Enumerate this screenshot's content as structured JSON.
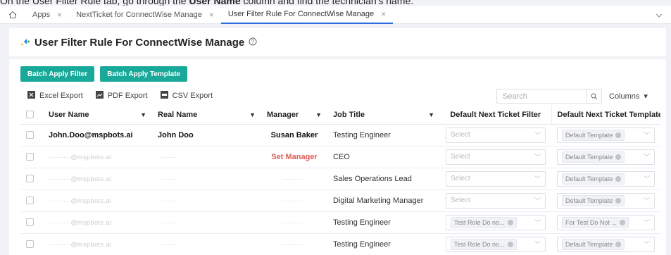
{
  "instruction": {
    "prefix": "On the User Filter Rule tab, go through the ",
    "bold": "User Name",
    "suffix": " column and find the technician's name."
  },
  "tabs": [
    {
      "label": "Apps"
    },
    {
      "label": "NextTicket for ConnectWise Manage"
    },
    {
      "label": "User Filter Rule For ConnectWise Manage"
    }
  ],
  "page": {
    "title": "User Filter Rule For ConnectWise Manage"
  },
  "actions": {
    "batch_filter": "Batch Apply Filter",
    "batch_template": "Batch Apply Template"
  },
  "toolbar": {
    "excel": "Excel Export",
    "pdf": "PDF Export",
    "csv": "CSV Export",
    "search_placeholder": "Search",
    "columns": "Columns"
  },
  "table": {
    "headers": {
      "user_name": "User Name",
      "real_name": "Real Name",
      "manager": "Manager",
      "job_title": "Job Title",
      "filter": "Default Next Ticket Filter",
      "template": "Default Next Ticket Template"
    },
    "rows": [
      {
        "user": "John.Doo@mspbots.ai",
        "real": "John Doo",
        "manager": "Susan Baker",
        "job": "Testing Engineer",
        "filter": "Select",
        "template": "Default Template"
      },
      {
        "user": "·········@mspbots.ai",
        "real": "········",
        "manager": "Set Manager",
        "job": "CEO",
        "filter": "Select",
        "template": "Default Template"
      },
      {
        "user": "·········@mspbots.ai",
        "real": "········",
        "manager": "··········",
        "job": "Sales Operations Lead",
        "filter": "Select",
        "template": "Default Template"
      },
      {
        "user": "·········@mspbots.ai",
        "real": "········",
        "manager": "··········",
        "job": "Digital Marketing Manager",
        "filter": "Select",
        "template": "Default Template"
      },
      {
        "user": "·········@mspbots.ai",
        "real": "········",
        "manager": "··········",
        "job": "Testing Engineer",
        "filter": "Test Role Do no...",
        "template": "For Test Do Not ..."
      },
      {
        "user": "·········@mspbots.ai",
        "real": "········",
        "manager": "··········",
        "job": "Testing Engineer",
        "filter": "Test Role Do no...",
        "template": "Default Template"
      }
    ]
  },
  "colors": {
    "accent": "#19a99a",
    "warning": "#e05a55",
    "tab_active": "#2d6cdf"
  }
}
